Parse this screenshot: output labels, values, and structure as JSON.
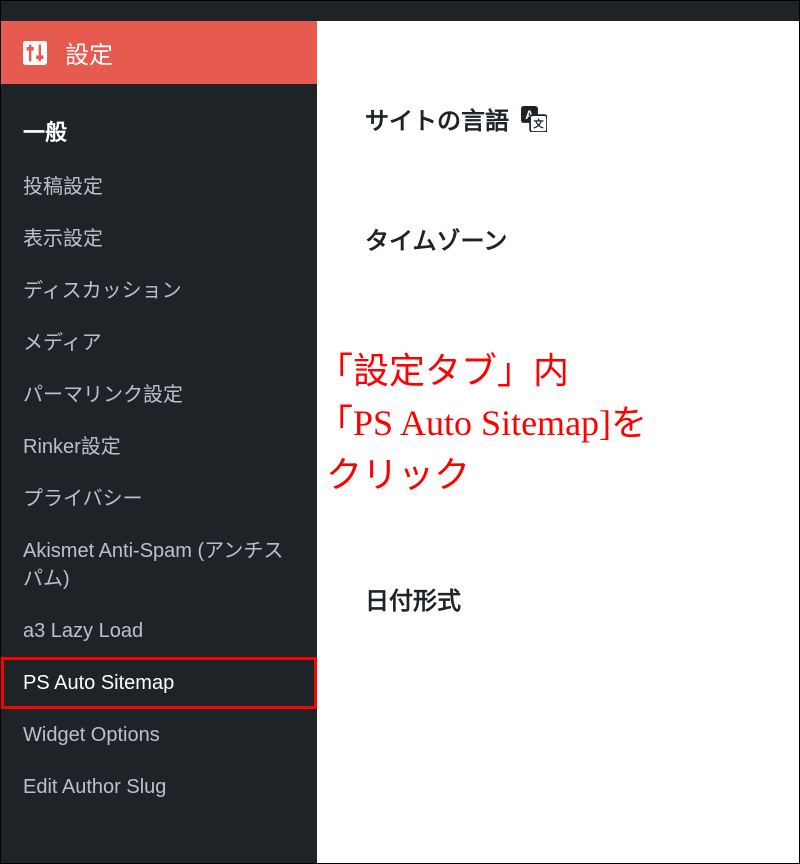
{
  "sidebar": {
    "header_label": "設定",
    "items": [
      {
        "label": "一般",
        "active": true
      },
      {
        "label": "投稿設定"
      },
      {
        "label": "表示設定"
      },
      {
        "label": "ディスカッション"
      },
      {
        "label": "メディア"
      },
      {
        "label": "パーマリンク設定"
      },
      {
        "label": "Rinker設定"
      },
      {
        "label": "プライバシー"
      },
      {
        "label": "Akismet Anti-Spam (アンチスパム)"
      },
      {
        "label": "a3 Lazy Load"
      },
      {
        "label": "PS Auto Sitemap",
        "highlighted": true
      },
      {
        "label": "Widget Options"
      },
      {
        "label": "Edit Author Slug"
      }
    ]
  },
  "main": {
    "site_language_label": "サイトの言語",
    "timezone_label": "タイムゾーン",
    "date_format_label": "日付形式"
  },
  "annotation": {
    "text": "「設定タブ」内\n「PS Auto Sitemap]を\n クリック"
  }
}
